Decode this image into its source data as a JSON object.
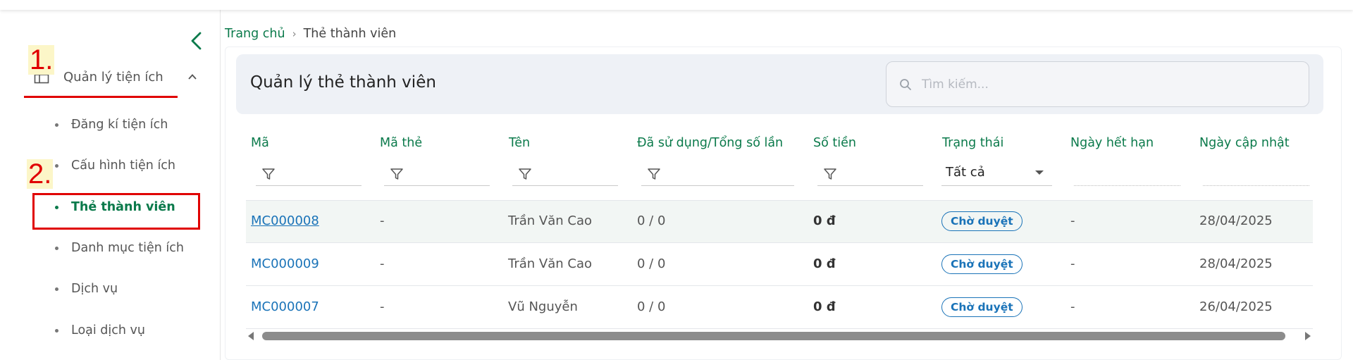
{
  "sidebar": {
    "group_label": "Quản lý tiện ích",
    "items": [
      {
        "label": "Đăng kí tiện ích"
      },
      {
        "label": "Cấu hình tiện ích"
      },
      {
        "label": "Thẻ thành viên"
      },
      {
        "label": "Danh mục tiện ích"
      },
      {
        "label": "Dịch vụ"
      },
      {
        "label": "Loại dịch vụ"
      }
    ]
  },
  "annotations": {
    "step1": "1.",
    "step2": "2.",
    "color": "#e00000"
  },
  "breadcrumb": {
    "home": "Trang chủ",
    "separator": "›",
    "current": "Thẻ thành viên"
  },
  "page": {
    "title": "Quản lý thẻ thành viên"
  },
  "search": {
    "placeholder": "Tìm kiếm..."
  },
  "table": {
    "columns": [
      "Mã",
      "Mã thẻ",
      "Tên",
      "Đã sử dụng/Tổng số lần",
      "Số tiền",
      "Trạng thái",
      "Ngày hết hạn",
      "Ngày cập nhật"
    ],
    "status_filter": "Tất cả",
    "rows": [
      {
        "code": "MC000008",
        "card": "-",
        "name": "Trần Văn Cao",
        "usage": "0 / 0",
        "amount": "0 đ",
        "status": "Chờ duyệt",
        "expiry": "-",
        "updated": "28/04/2025"
      },
      {
        "code": "MC000009",
        "card": "-",
        "name": "Trần Văn Cao",
        "usage": "0 / 0",
        "amount": "0 đ",
        "status": "Chờ duyệt",
        "expiry": "-",
        "updated": "28/04/2025"
      },
      {
        "code": "MC000007",
        "card": "-",
        "name": "Vũ Nguyễn",
        "usage": "0 / 0",
        "amount": "0 đ",
        "status": "Chờ duyệt",
        "expiry": "-",
        "updated": "26/04/2025"
      }
    ]
  },
  "colors": {
    "brand": "#0b7a4b",
    "link": "#1a73b8",
    "annotation": "#e00000"
  }
}
